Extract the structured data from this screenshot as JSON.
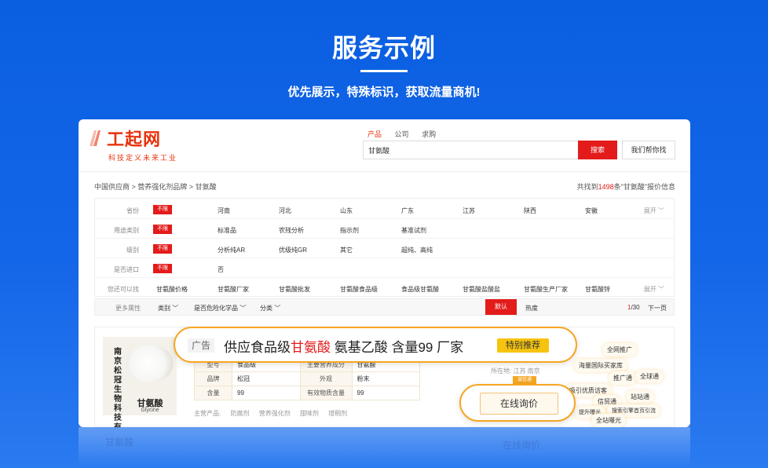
{
  "hero": {
    "title": "服务示例",
    "subtitle": "优先展示，特殊标识，获取流量商机!"
  },
  "site": {
    "logo_text": "工起网",
    "logo_slogan": "科技定义未来工业",
    "search_tabs": [
      "产品",
      "公司",
      "求购"
    ],
    "search_value": "甘氨酸",
    "search_button": "搜索",
    "help_button": "我们帮你找"
  },
  "breadcrumb": {
    "items": [
      "中国供应商",
      "营养强化剂品牌",
      "甘氨酸"
    ],
    "separator": " > "
  },
  "results": {
    "prefix": "共找到",
    "count": "1498",
    "suffix": "条\"甘氨酸\"报价信息"
  },
  "filters": [
    {
      "label": "省份",
      "badge": "不限",
      "options": [
        "河南",
        "河北",
        "山东",
        "广东",
        "江苏",
        "陕西",
        "安徽"
      ],
      "expand": "展开"
    },
    {
      "label": "用途类别",
      "badge": "不限",
      "options": [
        "标准品",
        "农残分析",
        "指示剂",
        "基准试剂"
      ],
      "expand": ""
    },
    {
      "label": "级别",
      "badge": "不限",
      "options": [
        "分析纯AR",
        "优级纯GR",
        "其它",
        "超纯、高纯"
      ],
      "expand": ""
    },
    {
      "label": "是否进口",
      "badge": "不限",
      "options": [
        "否"
      ],
      "expand": ""
    },
    {
      "label": "您还可以找",
      "badge": "",
      "options": [
        "甘氨酸价格",
        "甘氨酸厂家",
        "甘氨酸批发",
        "甘氨酸食品级",
        "食品级甘氨酸",
        "甘氨酸盐酸盐",
        "甘氨酸生产厂家",
        "甘氨酸锌"
      ],
      "expand": "展开"
    }
  ],
  "sortbar": {
    "more_label": "更多属性",
    "dropdowns": [
      "类别",
      "是否危险化学品",
      "分类"
    ],
    "default_label": "默认",
    "hot_label": "热度",
    "page_current": "1",
    "page_total": "/30",
    "next_label": "下一页"
  },
  "listing": {
    "image_vertical_text": "南京松冠生物科技有限",
    "image_name": "甘氨酸",
    "image_en": "Glycine",
    "spec_rows": [
      [
        "型号",
        "食品级",
        "主要营养成分",
        "甘氨酸"
      ],
      [
        "品牌",
        "松冠",
        "外观",
        "粉末"
      ],
      [
        "含量",
        "99",
        "有效物质含量",
        "99"
      ]
    ],
    "main_products_label": "主营产品:",
    "main_products": [
      "防腐剂",
      "营养强化剂",
      "甜味剂",
      "增稠剂"
    ],
    "location": "所在地: 江苏 南京",
    "tag": "诚信通",
    "cloud": [
      "全网推广",
      "海量国际买家库",
      "推广通",
      "全球通",
      "吸引优质访客",
      "信贸通",
      "站站通",
      "搜索引擎首页引流",
      "提升曝光",
      "全站曝光"
    ]
  },
  "ad": {
    "label": "广告",
    "text_before": "供应食品级",
    "text_highlight": "甘氨酸",
    "text_after": " 氨基乙酸 含量99 厂家",
    "badge": "特别推荐"
  },
  "inquiry": {
    "button": "在线询价"
  },
  "colors": {
    "brand_red": "#e31b1b",
    "accent_orange": "#f6a623",
    "highlight_yellow": "#f6c40f",
    "background_blue": "#0a5fe0"
  }
}
